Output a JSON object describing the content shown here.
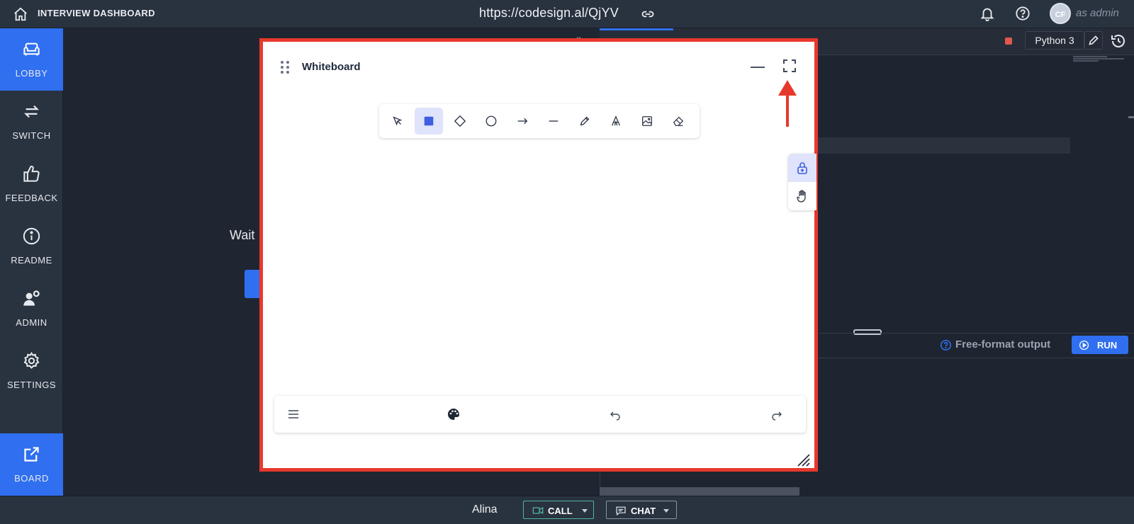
{
  "header": {
    "title": "INTERVIEW DASHBOARD",
    "url": "https://codesign.al/QjYV",
    "avatar_initials": "CF",
    "role_label": "as admin"
  },
  "sidebar": {
    "items": [
      {
        "label": "LOBBY",
        "active": true
      },
      {
        "label": "SWITCH",
        "active": false
      },
      {
        "label": "FEEDBACK",
        "active": false
      },
      {
        "label": "README",
        "active": false
      },
      {
        "label": "ADMIN",
        "active": false
      },
      {
        "label": "SETTINGS",
        "active": false
      }
    ],
    "board": {
      "label": "BOARD",
      "active": true
    }
  },
  "main": {
    "waiting_text": "Wait"
  },
  "editor": {
    "language": "Python 3",
    "output_label": "Free-format output",
    "run_label": "RUN"
  },
  "whiteboard": {
    "title": "Whiteboard",
    "tools": [
      "selection",
      "rectangle",
      "diamond",
      "ellipse",
      "arrow",
      "line",
      "draw",
      "text",
      "image",
      "eraser"
    ],
    "active_tool": "rectangle",
    "side_tools": [
      "lock",
      "hand"
    ],
    "active_side_tool": "lock"
  },
  "footer": {
    "peer_name": "Alina",
    "call_label": "CALL",
    "chat_label": "CHAT"
  },
  "colors": {
    "accent": "#2f6ff0",
    "highlight_border": "#e7392b",
    "call_border": "#4fb5a0"
  }
}
